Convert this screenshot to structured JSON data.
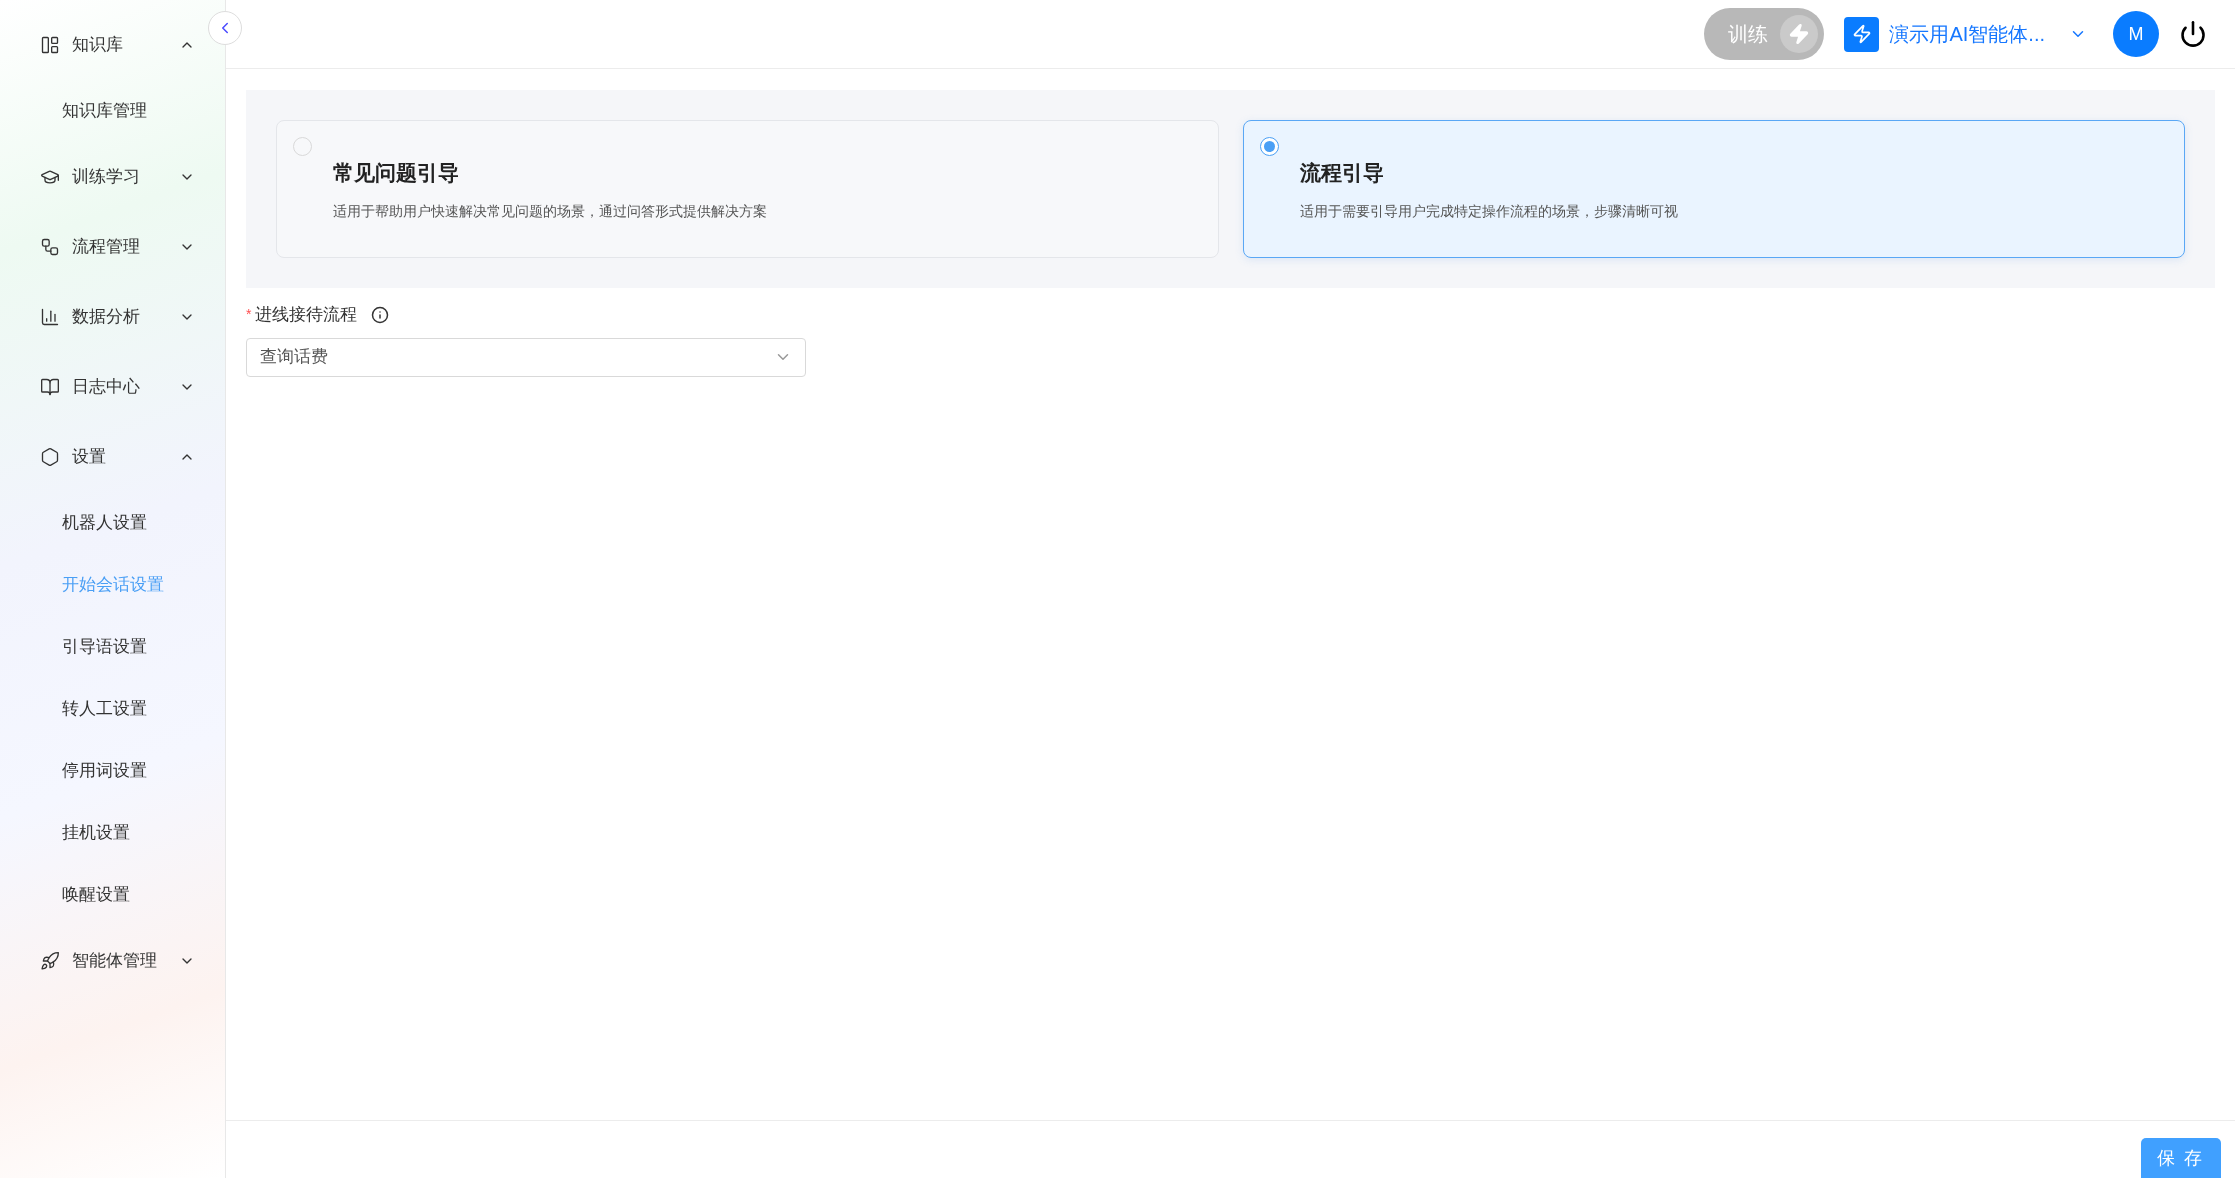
{
  "sidebar": {
    "groups": [
      {
        "label": "知识库",
        "expanded": true,
        "children": [
          {
            "label": "知识库管理",
            "selected": false
          }
        ]
      },
      {
        "label": "训练学习",
        "expanded": false
      },
      {
        "label": "流程管理",
        "expanded": false
      },
      {
        "label": "数据分析",
        "expanded": false
      },
      {
        "label": "日志中心",
        "expanded": false
      },
      {
        "label": "设置",
        "expanded": true,
        "children": [
          {
            "label": "机器人设置",
            "selected": false
          },
          {
            "label": "开始会话设置",
            "selected": true
          },
          {
            "label": "引导语设置",
            "selected": false
          },
          {
            "label": "转人工设置",
            "selected": false
          },
          {
            "label": "停用词设置",
            "selected": false
          },
          {
            "label": "挂机设置",
            "selected": false
          },
          {
            "label": "唤醒设置",
            "selected": false
          }
        ]
      },
      {
        "label": "智能体管理",
        "expanded": false
      }
    ]
  },
  "header": {
    "train_button": {
      "label": "训练",
      "disabled": true
    },
    "agent": {
      "name": "演示用AI智能体..."
    },
    "avatar": {
      "initial": "M"
    }
  },
  "options": [
    {
      "title": "常见问题引导",
      "description": "适用于帮助用户快速解决常见问题的场景，通过问答形式提供解决方案",
      "selected": false
    },
    {
      "title": "流程引导",
      "description": "适用于需要引导用户完成特定操作流程的场景，步骤清晰可视",
      "selected": true
    }
  ],
  "form": {
    "label": "进线接待流程",
    "required": true,
    "required_mark": "*",
    "value": "查询话费"
  },
  "footer": {
    "save_button": "保 存"
  }
}
